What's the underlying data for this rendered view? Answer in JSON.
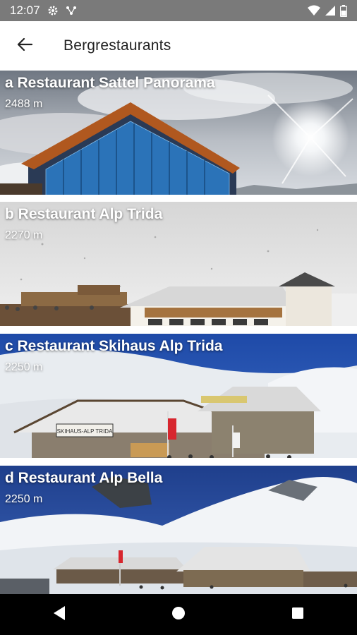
{
  "status_bar": {
    "time": "12:07",
    "icons": [
      "gear-icon",
      "network-icon",
      "wifi-icon",
      "signal-icon",
      "battery-icon"
    ]
  },
  "app_bar": {
    "back_icon": "arrow-left-icon",
    "title": "Bergrestaurants"
  },
  "restaurants": [
    {
      "title": "a Restaurant Sattel Panorama",
      "altitude": "2488 m"
    },
    {
      "title": "b Restaurant Alp Trida",
      "altitude": "2270 m"
    },
    {
      "title": "c Restaurant Skihaus Alp Trida",
      "altitude": "2250 m"
    },
    {
      "title": "d Restaurant Alp Bella",
      "altitude": "2250 m"
    }
  ],
  "nav_bar": {
    "icons": [
      "back-triangle-icon",
      "home-circle-icon",
      "recents-square-icon"
    ]
  }
}
